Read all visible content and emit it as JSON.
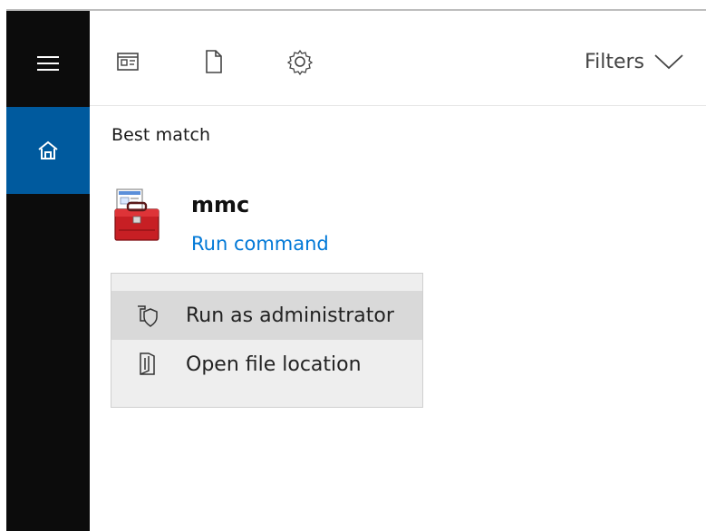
{
  "top_tools": {
    "filters_label": "Filters"
  },
  "search_results": {
    "section_title": "Best match",
    "best_match": {
      "title": "mmc",
      "subtitle": "Run command"
    }
  },
  "context_menu": {
    "items": [
      {
        "label": "Run as administrator"
      },
      {
        "label": "Open file location"
      }
    ]
  },
  "colors": {
    "left_rail": "#0c0c0c",
    "selected_home": "#005a9e",
    "link": "#0078d7",
    "menu_background": "#eeeeee",
    "menu_hover": "#d9d9d9"
  },
  "icons": {
    "menu": "hamburger-menu-icon",
    "home": "home-icon",
    "apps": "apps-icon",
    "documents": "document-icon",
    "settings": "settings-icon",
    "filters": "chevron-down-icon",
    "mmc": "toolbox-icon",
    "admin": "admin-shield-icon",
    "folder": "open-folder-icon"
  }
}
